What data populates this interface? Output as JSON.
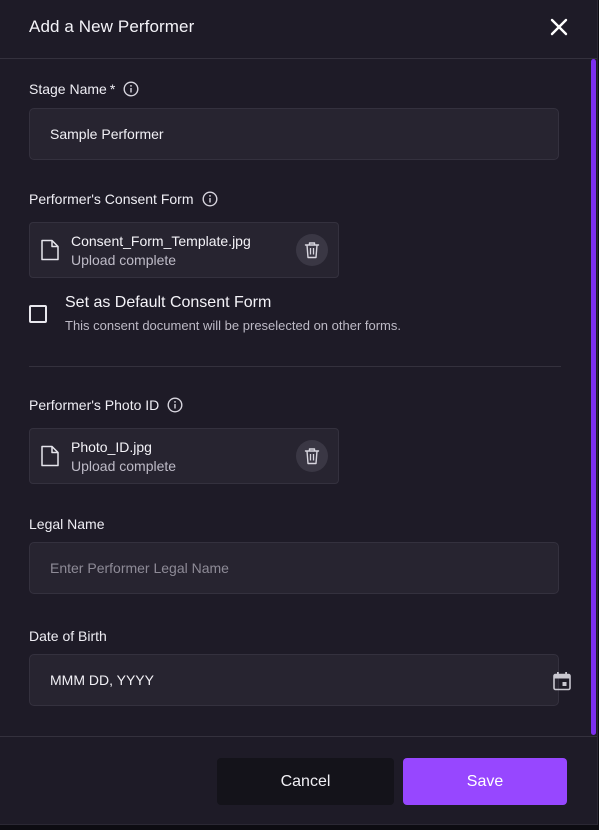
{
  "dialog": {
    "title": "Add a New Performer"
  },
  "form": {
    "stage_name": {
      "label": "Stage Name",
      "required_mark": "*",
      "value": "Sample Performer"
    },
    "consent_form": {
      "label": "Performer's Consent Form",
      "file_name": "Consent_Form_Template.jpg",
      "status": "Upload complete"
    },
    "default_consent": {
      "label": "Set as Default Consent Form",
      "description": "This consent document will be preselected on other forms.",
      "checked": false
    },
    "photo_id": {
      "label": "Performer's Photo ID",
      "file_name": "Photo_ID.jpg",
      "status": "Upload complete"
    },
    "legal_name": {
      "label": "Legal Name",
      "placeholder": "Enter Performer Legal Name",
      "value": ""
    },
    "date_of_birth": {
      "label": "Date of Birth",
      "value": "MMM DD, YYYY"
    }
  },
  "footer": {
    "cancel_label": "Cancel",
    "save_label": "Save"
  },
  "icons": {
    "close": "close-icon",
    "info": "info-icon",
    "file": "file-icon",
    "trash": "trash-icon",
    "calendar": "calendar-icon"
  },
  "colors": {
    "background": "#1e1b27",
    "field": "#272430",
    "accent": "#9747ff",
    "scrollbar": "#7c2ff0"
  }
}
